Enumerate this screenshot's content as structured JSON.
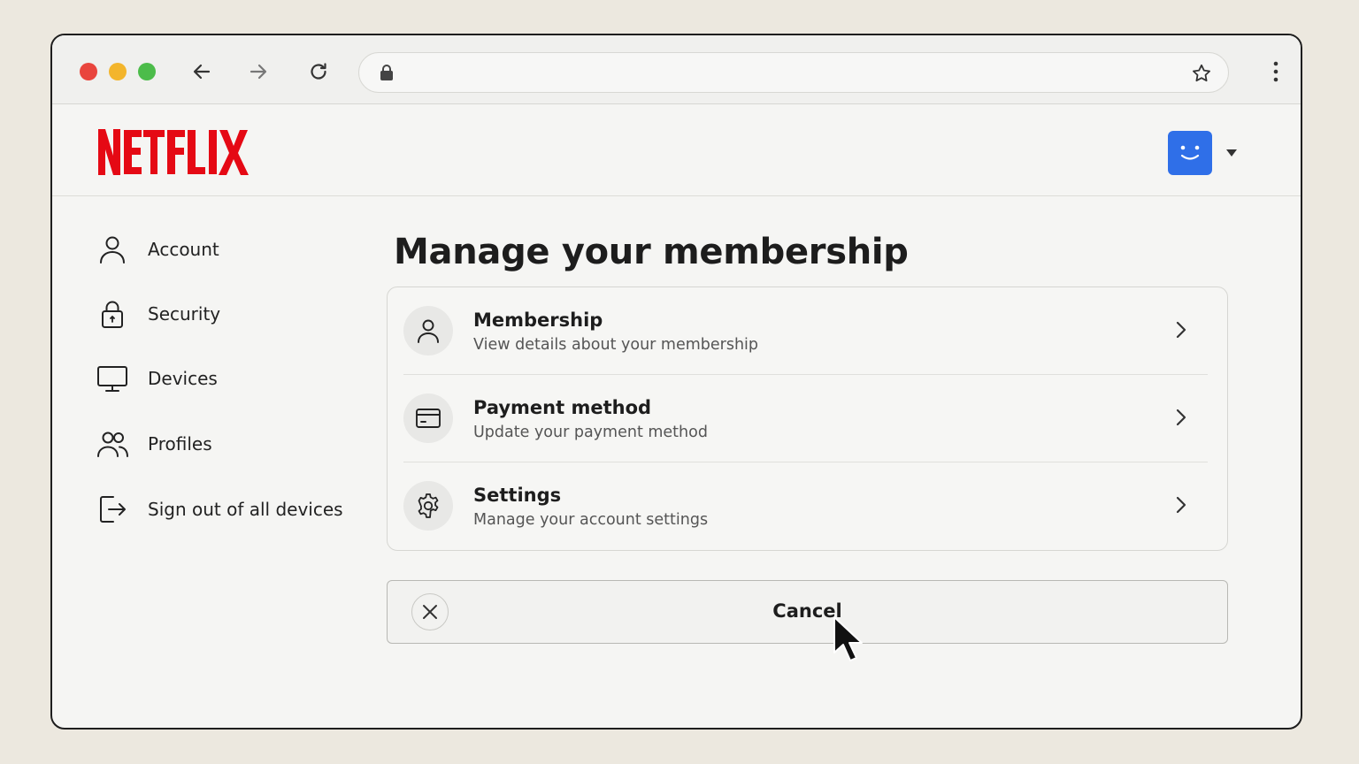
{
  "browser": {
    "url_value": "",
    "icons": [
      "arrow-left-icon",
      "arrow-right-icon",
      "reload-icon",
      "lock-icon",
      "star-icon",
      "more-vert-icon"
    ]
  },
  "brand": {
    "logo_text": "NETFLIX",
    "logo_color": "#e50914",
    "avatar_color": "#2f6fe8"
  },
  "sidebar": {
    "items": [
      {
        "label": "Account",
        "icon": "person-icon"
      },
      {
        "label": "Security",
        "icon": "lock-icon"
      },
      {
        "label": "Devices",
        "icon": "monitor-icon"
      },
      {
        "label": "Profiles",
        "icon": "people-icon"
      },
      {
        "label": "Sign out of all devices",
        "icon": "sign-out-icon"
      }
    ]
  },
  "main": {
    "title": "Manage your membership",
    "rows": [
      {
        "title": "Membership",
        "subtitle": "View details about your membership",
        "icon": "person-icon"
      },
      {
        "title": "Payment method",
        "subtitle": "Update your payment method",
        "icon": "credit-card-icon"
      },
      {
        "title": "Settings",
        "subtitle": "Manage your account settings",
        "icon": "gear-icon"
      }
    ],
    "cancel_label": "Cancel"
  }
}
